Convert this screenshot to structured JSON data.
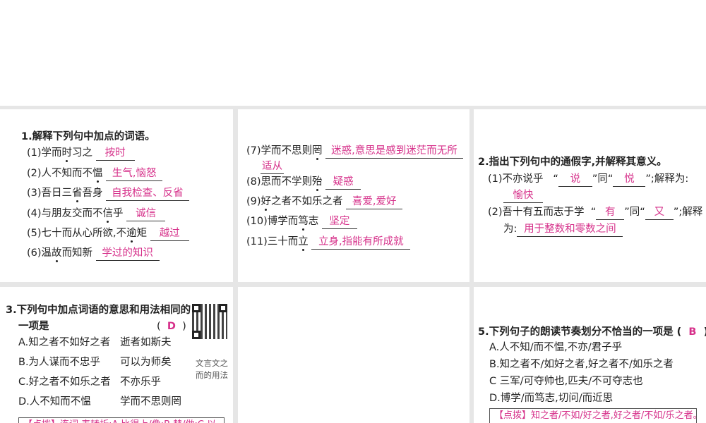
{
  "q1": {
    "title": "1.解释下列句中加点的词语。",
    "items": [
      {
        "pre": "(1)学而",
        "dot": "时",
        "post": "习之",
        "ans": "按时"
      },
      {
        "pre": "(2)人不知而不",
        "dot": "愠",
        "post": "",
        "ans": "生气,恼怒"
      },
      {
        "pre": "(3)吾日三",
        "dot": "省",
        "post": "吾身",
        "ans": "自我检查、反省"
      },
      {
        "pre": "(4)与朋友交而不",
        "dot": "信",
        "post": "乎",
        "ans": "诚信"
      },
      {
        "pre": "(5)七十而从心所欲,不",
        "dot": "逾",
        "post": "矩",
        "ans": "越过"
      },
      {
        "pre": "(6)温",
        "dot": "故",
        "post": "而知新",
        "ans": "学过的知识"
      }
    ]
  },
  "q1b": {
    "items": [
      {
        "pre": "(7)学而不思则",
        "dot": "罔",
        "post": "",
        "ans": "迷惑,意思是感到迷茫而无所",
        "ans2": "适从"
      },
      {
        "pre": "(8)思而不学则",
        "dot": "殆",
        "post": "",
        "ans": "疑惑"
      },
      {
        "pre": "(9)",
        "dot": "好",
        "post": "之者不如乐之者",
        "ans": "喜爱,爱好"
      },
      {
        "pre": "(10)博学而",
        "dot": "笃",
        "post": "志",
        "ans": "坚定"
      },
      {
        "pre": "(11)三十而",
        "dot": "立",
        "post": "",
        "ans": "立身,指能有所成就"
      }
    ]
  },
  "q2": {
    "title": "2.指出下列句中的通假字,并解释其意义。",
    "i1": {
      "text": "(1)不亦说乎",
      "a": "说",
      "same": "”同“",
      "b": "悦",
      "tail": "”;解释为:",
      "ans": "愉快",
      "open": "“"
    },
    "i2": {
      "text": "(2)吾十有五而志于学",
      "a": "有",
      "same": "”同“",
      "b": "又",
      "tail": "”;解释",
      "tail2": "为:",
      "ans": "用于整数和零数之间",
      "open": "“"
    }
  },
  "q3": {
    "title": "3.下列句中加点词语的意思和用法相同的",
    "title2": "一项是",
    "paren_l": "(",
    "answer": "D",
    "paren_r": ")",
    "options": [
      {
        "l": "A.知之者不如好之者",
        "r": "逝者如斯夫"
      },
      {
        "l": "B.为人谋而不忠乎",
        "r": "可以为师矣"
      },
      {
        "l": "C.好之者不如乐之者",
        "r": "不亦乐乎"
      },
      {
        "l": "D.人不知而不愠",
        "r": "学而不思则罔"
      }
    ],
    "qr_caption1": "文言文之",
    "qr_caption2": "而的用法",
    "hint": "【点拨】连词,表转折;A.比得上/像;B.替/做;C.以……为"
  },
  "q5": {
    "title": "5.下列句子的朗读节奏划分不恰当的一项是",
    "paren_l": "(",
    "answer": "B",
    "paren_r": ")",
    "options": [
      "A.人不知/而不愠,不亦/君子乎",
      "B.知之者不/如好之者,好之者不/如乐之者",
      "C 三军/可夺帅也,匹夫/不可夺志也",
      "D.博学/而笃志,切问/而近思"
    ],
    "hint": "【点拨】知之者/不如/好之者,好之者/不如/乐之者。"
  }
}
